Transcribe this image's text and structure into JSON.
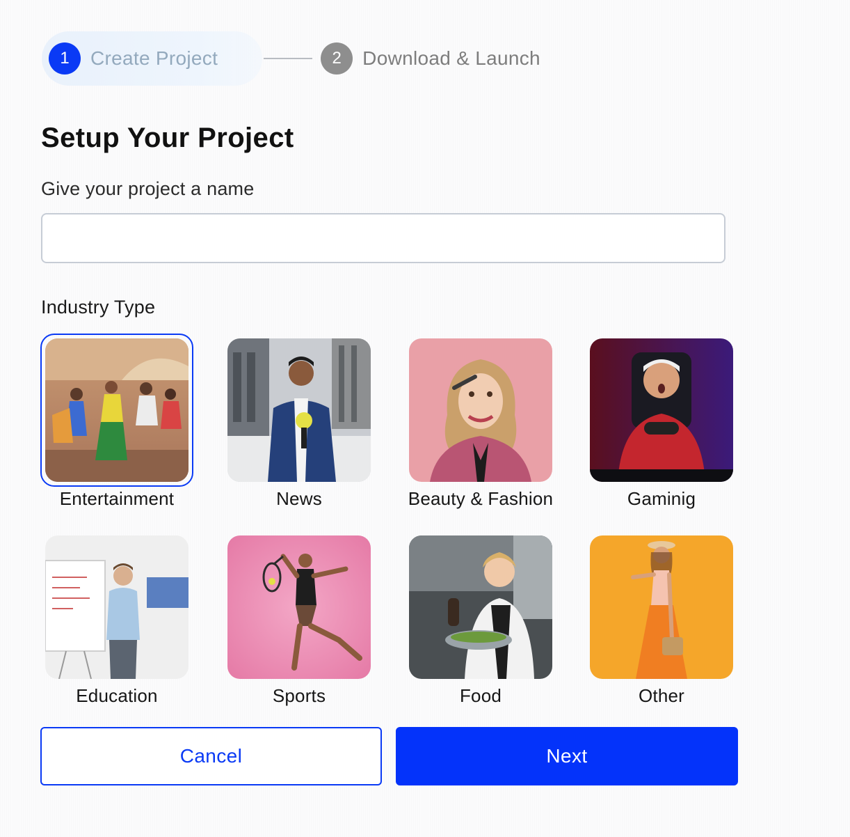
{
  "stepper": {
    "steps": [
      {
        "number": "1",
        "label": "Create Project",
        "state": "active"
      },
      {
        "number": "2",
        "label": "Download & Launch",
        "state": "inactive"
      }
    ]
  },
  "page": {
    "title": "Setup Your Project"
  },
  "project_name": {
    "label": "Give your project a name",
    "value": "",
    "placeholder": ""
  },
  "industry": {
    "label": "Industry Type",
    "selected": "Entertainment",
    "options": [
      {
        "label": "Entertainment",
        "image": "dancers-photo"
      },
      {
        "label": "News",
        "image": "news-reporter-photo"
      },
      {
        "label": "Beauty & Fashion",
        "image": "makeup-woman-photo"
      },
      {
        "label": "Gaminig",
        "image": "gamer-photo"
      },
      {
        "label": "Education",
        "image": "teacher-whiteboard-photo"
      },
      {
        "label": "Sports",
        "image": "tennis-player-photo"
      },
      {
        "label": "Food",
        "image": "chef-cooking-photo"
      },
      {
        "label": "Other",
        "image": "woman-orange-dress-photo"
      }
    ]
  },
  "actions": {
    "cancel_label": "Cancel",
    "next_label": "Next"
  },
  "colors": {
    "accent": "#0a3af5",
    "step_inactive": "#8e8e8e",
    "input_border": "#c6ccd5"
  }
}
